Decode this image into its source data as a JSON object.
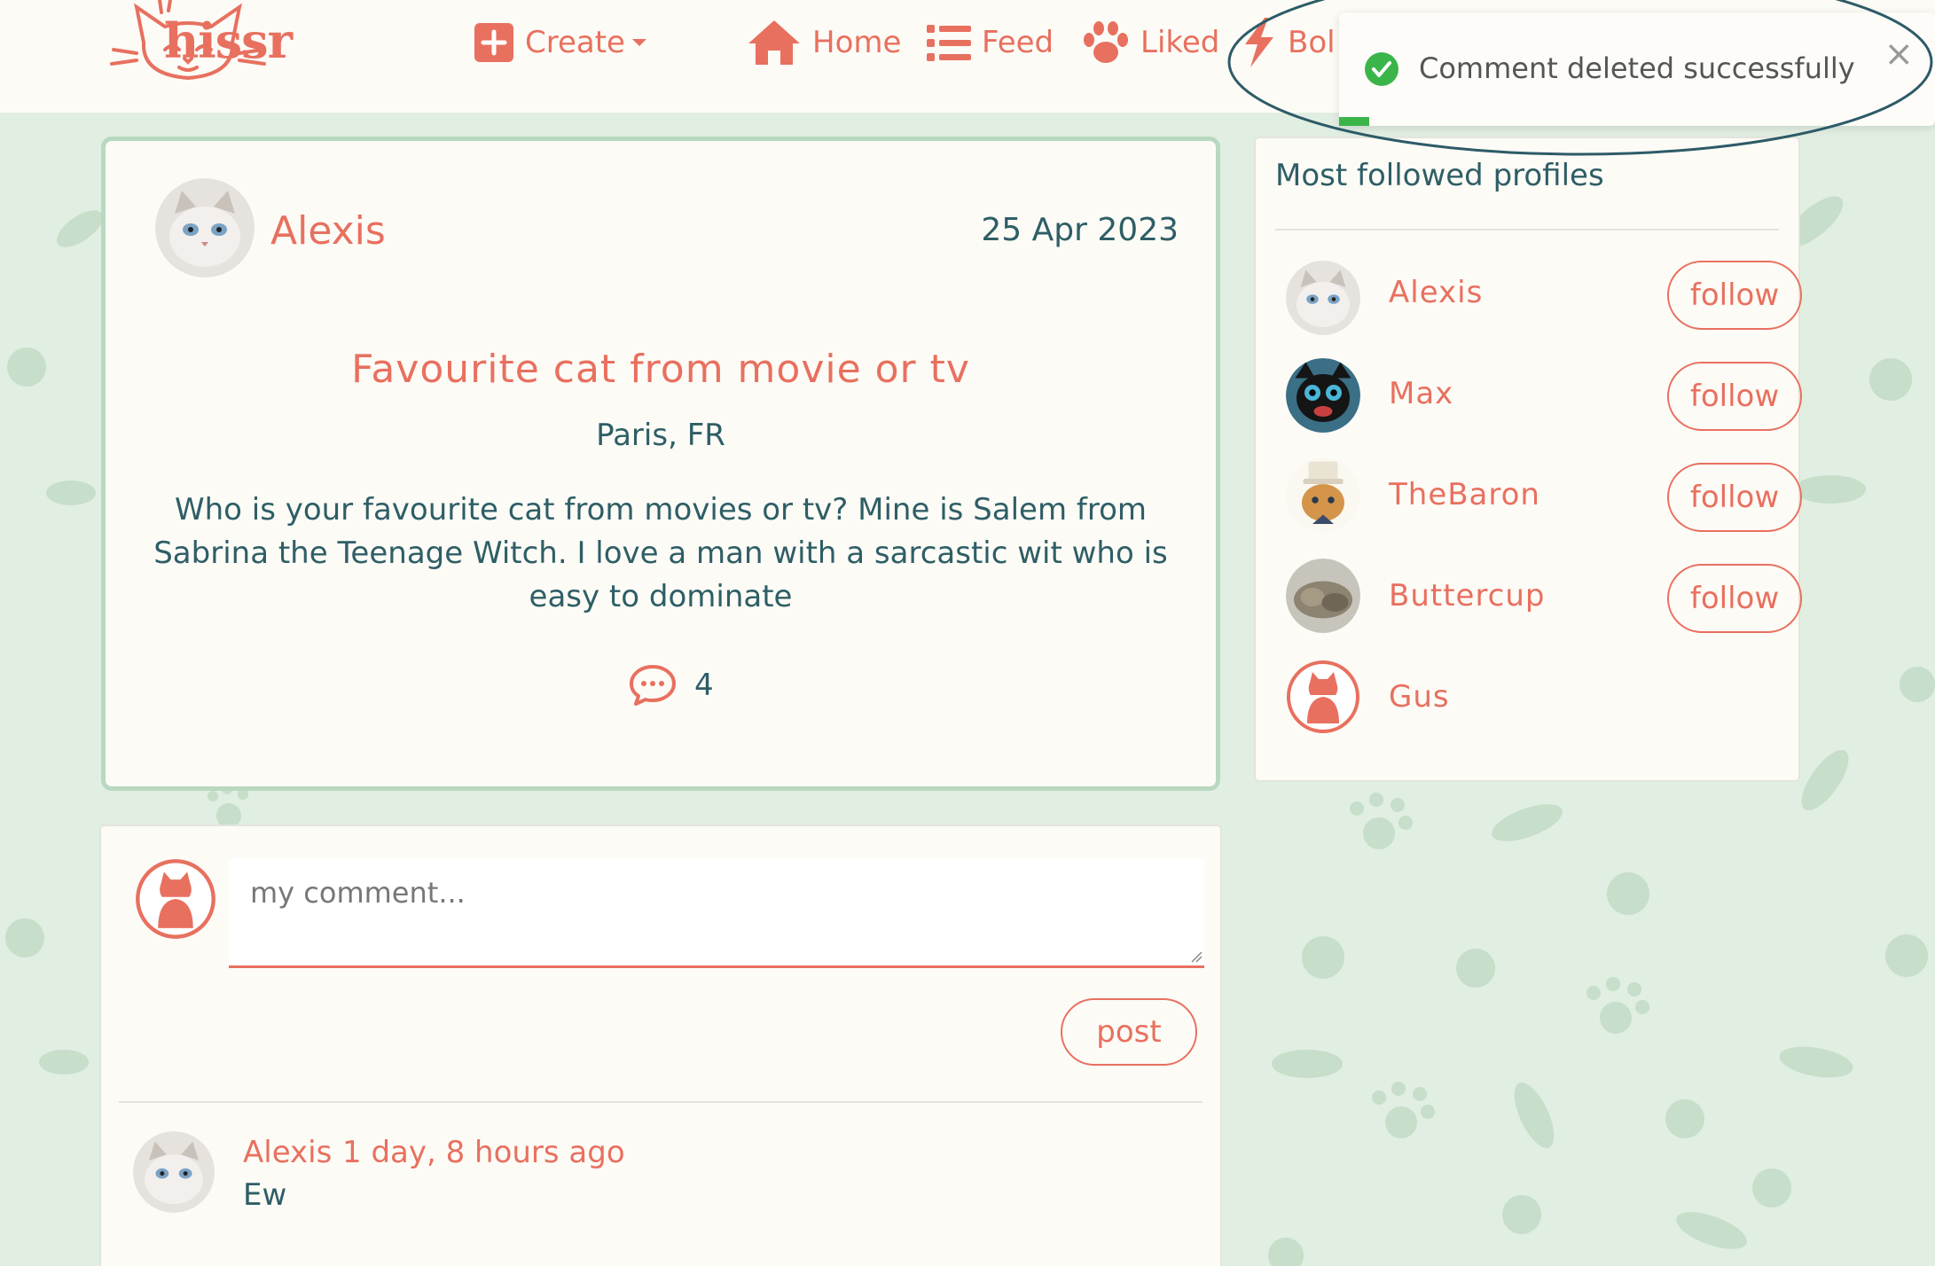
{
  "nav": {
    "brand": "hissr",
    "items": [
      {
        "label": "Create",
        "icon": "plus-square-icon"
      },
      {
        "label": "Home",
        "icon": "house-icon"
      },
      {
        "label": "Feed",
        "icon": "list-icon"
      },
      {
        "label": "Liked",
        "icon": "paw-icon"
      },
      {
        "label": "Bol",
        "icon": "bolt-icon"
      }
    ]
  },
  "toast": {
    "message": "Comment deleted successfully",
    "close": "×"
  },
  "post": {
    "author": "Alexis",
    "date": "25 Apr 2023",
    "title": "Favourite cat from movie or tv",
    "location": "Paris, FR",
    "body": "Who is your favourite cat from movies or tv? Mine is Salem from Sabrina the Teenage Witch. I love a man with a sarcastic wit who is easy to dominate",
    "comment_count": "4"
  },
  "sidebar": {
    "title": "Most followed profiles",
    "profiles": [
      {
        "name": "Alexis",
        "follow": "follow"
      },
      {
        "name": "Max",
        "follow": "follow"
      },
      {
        "name": "TheBaron",
        "follow": "follow"
      },
      {
        "name": "Buttercup",
        "follow": "follow"
      },
      {
        "name": "Gus"
      }
    ]
  },
  "comment_form": {
    "placeholder": "my comment...",
    "post_label": "post"
  },
  "comments": [
    {
      "author": "Alexis",
      "time": "1 day, 8 hours ago",
      "text": "Ew"
    }
  ],
  "colors": {
    "accent": "#e8705f",
    "text": "#2e5e66",
    "background": "#e1eee2",
    "card": "#fdfbf6",
    "success": "#3bb54a"
  }
}
